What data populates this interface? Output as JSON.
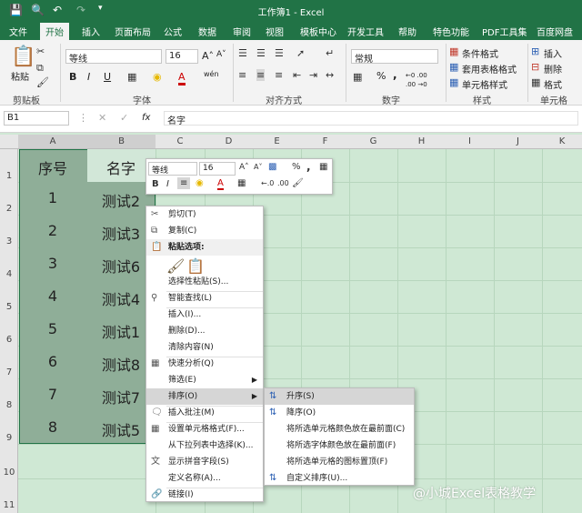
{
  "window": {
    "title": "工作簿1 - Excel"
  },
  "ribbon_tabs": [
    "文件",
    "开始",
    "插入",
    "页面布局",
    "公式",
    "数据",
    "审阅",
    "视图",
    "模板中心",
    "开发工具",
    "帮助",
    "特色功能",
    "PDF工具集",
    "百度网盘"
  ],
  "active_tab": "开始",
  "ribbon": {
    "clipboard": {
      "paste": "粘贴",
      "group": "剪贴板"
    },
    "font": {
      "name": "等线",
      "size": "16",
      "group": "字体",
      "bold": "B",
      "italic": "I",
      "underline": "U",
      "grow": "A˄",
      "shrink": "A˅",
      "fill_a": "A",
      "wen": "wén"
    },
    "alignment": {
      "group": "对齐方式"
    },
    "number": {
      "format": "常规",
      "group": "数字",
      "percent": "%",
      "comma": ",",
      "inc": "←0 .00",
      "dec": ".00 →0"
    },
    "styles": {
      "conditional": "条件格式",
      "table": "套用表格格式",
      "cell": "单元格样式",
      "group": "样式"
    },
    "cells": {
      "insert": "插入",
      "delete": "删除",
      "format": "格式",
      "group": "单元格"
    }
  },
  "formula_bar": {
    "name_box": "B1",
    "content": "名字",
    "fx": "fx"
  },
  "columns": [
    "A",
    "B",
    "C",
    "D",
    "E",
    "F",
    "G",
    "H",
    "I",
    "J",
    "K"
  ],
  "rows": [
    "1",
    "2",
    "3",
    "4",
    "5",
    "6",
    "7",
    "8",
    "9",
    "10",
    "11"
  ],
  "cells": [
    [
      "序号",
      "名字"
    ],
    [
      "1",
      "测试2"
    ],
    [
      "2",
      "测试3"
    ],
    [
      "3",
      "测试6"
    ],
    [
      "4",
      "测试4"
    ],
    [
      "5",
      "测试1"
    ],
    [
      "6",
      "测试8"
    ],
    [
      "7",
      "测试7"
    ],
    [
      "8",
      "测试5"
    ]
  ],
  "mini_toolbar": {
    "font": "等线",
    "size": "16",
    "bold": "B",
    "italic": "I",
    "fill_a": "A"
  },
  "context_menu": {
    "items": [
      {
        "label": "剪切(T)",
        "icon": "scissors-icon"
      },
      {
        "label": "复制(C)",
        "icon": "copy-icon"
      },
      {
        "label": "粘贴选项:",
        "icon": "paste-icon"
      },
      {
        "label": "选择性粘贴(S)...",
        "icon": ""
      },
      {
        "label": "智能查找(L)",
        "icon": "search-icon"
      },
      {
        "label": "插入(I)...",
        "icon": ""
      },
      {
        "label": "删除(D)...",
        "icon": ""
      },
      {
        "label": "清除内容(N)",
        "icon": ""
      },
      {
        "label": "快速分析(Q)",
        "icon": "quick-analysis-icon"
      },
      {
        "label": "筛选(E)",
        "icon": ""
      },
      {
        "label": "排序(O)",
        "icon": ""
      },
      {
        "label": "插入批注(M)",
        "icon": "comment-icon"
      },
      {
        "label": "设置单元格格式(F)...",
        "icon": "format-cells-icon"
      },
      {
        "label": "从下拉列表中选择(K)...",
        "icon": ""
      },
      {
        "label": "显示拼音字段(S)",
        "icon": "pinyin-icon"
      },
      {
        "label": "定义名称(A)...",
        "icon": ""
      },
      {
        "label": "链接(I)",
        "icon": "link-icon"
      }
    ]
  },
  "sort_submenu": {
    "items": [
      {
        "label": "升序(S)",
        "icon": "sort-asc-icon"
      },
      {
        "label": "降序(O)",
        "icon": "sort-desc-icon"
      },
      {
        "label": "将所选单元格颜色放在最前面(C)",
        "icon": ""
      },
      {
        "label": "将所选字体颜色放在最前面(F)",
        "icon": ""
      },
      {
        "label": "将所选单元格的图标置顶(F)",
        "icon": ""
      },
      {
        "label": "自定义排序(U)...",
        "icon": "custom-sort-icon"
      }
    ]
  },
  "watermark": "@小城Excel表格教学",
  "colors": {
    "accent": "#217346",
    "selection": "#8fae98",
    "grid_bg": "#cfe8d4"
  }
}
